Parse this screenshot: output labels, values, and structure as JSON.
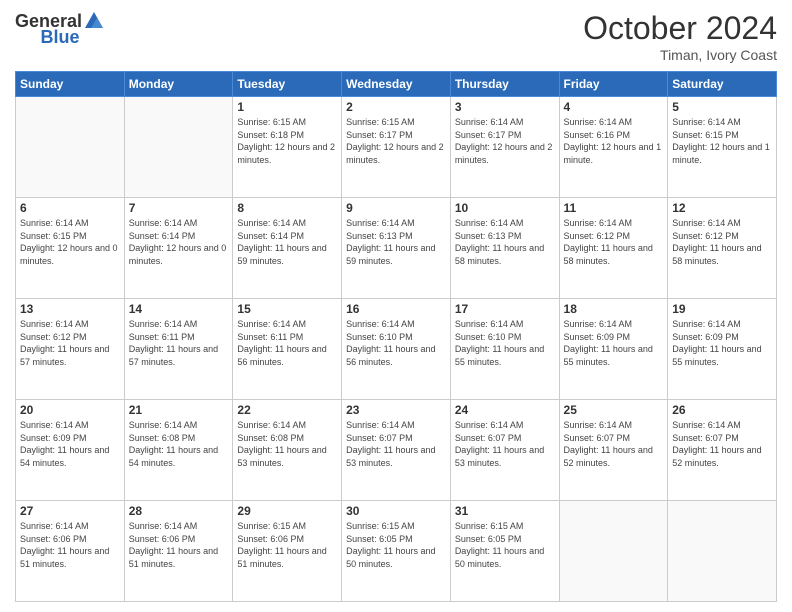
{
  "header": {
    "logo_general": "General",
    "logo_blue": "Blue",
    "month_title": "October 2024",
    "subtitle": "Timan, Ivory Coast"
  },
  "weekdays": [
    "Sunday",
    "Monday",
    "Tuesday",
    "Wednesday",
    "Thursday",
    "Friday",
    "Saturday"
  ],
  "weeks": [
    [
      {
        "day": "",
        "info": ""
      },
      {
        "day": "",
        "info": ""
      },
      {
        "day": "1",
        "info": "Sunrise: 6:15 AM\nSunset: 6:18 PM\nDaylight: 12 hours and 2 minutes."
      },
      {
        "day": "2",
        "info": "Sunrise: 6:15 AM\nSunset: 6:17 PM\nDaylight: 12 hours and 2 minutes."
      },
      {
        "day": "3",
        "info": "Sunrise: 6:14 AM\nSunset: 6:17 PM\nDaylight: 12 hours and 2 minutes."
      },
      {
        "day": "4",
        "info": "Sunrise: 6:14 AM\nSunset: 6:16 PM\nDaylight: 12 hours and 1 minute."
      },
      {
        "day": "5",
        "info": "Sunrise: 6:14 AM\nSunset: 6:15 PM\nDaylight: 12 hours and 1 minute."
      }
    ],
    [
      {
        "day": "6",
        "info": "Sunrise: 6:14 AM\nSunset: 6:15 PM\nDaylight: 12 hours and 0 minutes."
      },
      {
        "day": "7",
        "info": "Sunrise: 6:14 AM\nSunset: 6:14 PM\nDaylight: 12 hours and 0 minutes."
      },
      {
        "day": "8",
        "info": "Sunrise: 6:14 AM\nSunset: 6:14 PM\nDaylight: 11 hours and 59 minutes."
      },
      {
        "day": "9",
        "info": "Sunrise: 6:14 AM\nSunset: 6:13 PM\nDaylight: 11 hours and 59 minutes."
      },
      {
        "day": "10",
        "info": "Sunrise: 6:14 AM\nSunset: 6:13 PM\nDaylight: 11 hours and 58 minutes."
      },
      {
        "day": "11",
        "info": "Sunrise: 6:14 AM\nSunset: 6:12 PM\nDaylight: 11 hours and 58 minutes."
      },
      {
        "day": "12",
        "info": "Sunrise: 6:14 AM\nSunset: 6:12 PM\nDaylight: 11 hours and 58 minutes."
      }
    ],
    [
      {
        "day": "13",
        "info": "Sunrise: 6:14 AM\nSunset: 6:12 PM\nDaylight: 11 hours and 57 minutes."
      },
      {
        "day": "14",
        "info": "Sunrise: 6:14 AM\nSunset: 6:11 PM\nDaylight: 11 hours and 57 minutes."
      },
      {
        "day": "15",
        "info": "Sunrise: 6:14 AM\nSunset: 6:11 PM\nDaylight: 11 hours and 56 minutes."
      },
      {
        "day": "16",
        "info": "Sunrise: 6:14 AM\nSunset: 6:10 PM\nDaylight: 11 hours and 56 minutes."
      },
      {
        "day": "17",
        "info": "Sunrise: 6:14 AM\nSunset: 6:10 PM\nDaylight: 11 hours and 55 minutes."
      },
      {
        "day": "18",
        "info": "Sunrise: 6:14 AM\nSunset: 6:09 PM\nDaylight: 11 hours and 55 minutes."
      },
      {
        "day": "19",
        "info": "Sunrise: 6:14 AM\nSunset: 6:09 PM\nDaylight: 11 hours and 55 minutes."
      }
    ],
    [
      {
        "day": "20",
        "info": "Sunrise: 6:14 AM\nSunset: 6:09 PM\nDaylight: 11 hours and 54 minutes."
      },
      {
        "day": "21",
        "info": "Sunrise: 6:14 AM\nSunset: 6:08 PM\nDaylight: 11 hours and 54 minutes."
      },
      {
        "day": "22",
        "info": "Sunrise: 6:14 AM\nSunset: 6:08 PM\nDaylight: 11 hours and 53 minutes."
      },
      {
        "day": "23",
        "info": "Sunrise: 6:14 AM\nSunset: 6:07 PM\nDaylight: 11 hours and 53 minutes."
      },
      {
        "day": "24",
        "info": "Sunrise: 6:14 AM\nSunset: 6:07 PM\nDaylight: 11 hours and 53 minutes."
      },
      {
        "day": "25",
        "info": "Sunrise: 6:14 AM\nSunset: 6:07 PM\nDaylight: 11 hours and 52 minutes."
      },
      {
        "day": "26",
        "info": "Sunrise: 6:14 AM\nSunset: 6:07 PM\nDaylight: 11 hours and 52 minutes."
      }
    ],
    [
      {
        "day": "27",
        "info": "Sunrise: 6:14 AM\nSunset: 6:06 PM\nDaylight: 11 hours and 51 minutes."
      },
      {
        "day": "28",
        "info": "Sunrise: 6:14 AM\nSunset: 6:06 PM\nDaylight: 11 hours and 51 minutes."
      },
      {
        "day": "29",
        "info": "Sunrise: 6:15 AM\nSunset: 6:06 PM\nDaylight: 11 hours and 51 minutes."
      },
      {
        "day": "30",
        "info": "Sunrise: 6:15 AM\nSunset: 6:05 PM\nDaylight: 11 hours and 50 minutes."
      },
      {
        "day": "31",
        "info": "Sunrise: 6:15 AM\nSunset: 6:05 PM\nDaylight: 11 hours and 50 minutes."
      },
      {
        "day": "",
        "info": ""
      },
      {
        "day": "",
        "info": ""
      }
    ]
  ]
}
